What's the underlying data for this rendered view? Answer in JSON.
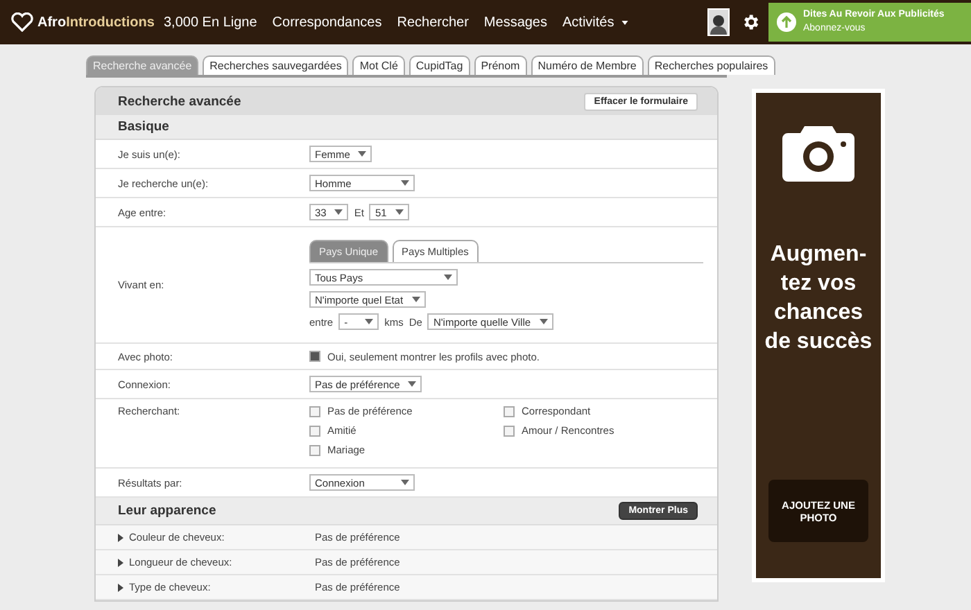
{
  "header": {
    "logo": {
      "part_1": "Afro",
      "part_2": "Introductions"
    },
    "nav": [
      {
        "label": "3,000 En Ligne",
        "dropdown": false
      },
      {
        "label": "Correspondances",
        "dropdown": false
      },
      {
        "label": "Rechercher",
        "dropdown": false
      },
      {
        "label": "Messages",
        "dropdown": false
      },
      {
        "label": "Activités",
        "dropdown": true
      }
    ],
    "promo": {
      "title": "Dites Au Revoir Aux Publicités",
      "subtitle": "Abonnez-vous"
    }
  },
  "tabs": [
    {
      "label": "Recherche avancée",
      "selected": true
    },
    {
      "label": "Recherches sauvegardées",
      "selected": false
    },
    {
      "label": "Mot Clé",
      "selected": false
    },
    {
      "label": "CupidTag",
      "selected": false
    },
    {
      "label": "Prénom",
      "selected": false
    },
    {
      "label": "Numéro de Membre",
      "selected": false
    },
    {
      "label": "Recherches populaires",
      "selected": false
    }
  ],
  "panel": {
    "title": "Recherche avancée",
    "clear_button": "Effacer le formulaire"
  },
  "basic": {
    "title": "Basique",
    "rows": [
      {
        "kind": "dropdown",
        "label": "Je suis un(e):",
        "value": "Femme"
      },
      {
        "kind": "select",
        "label": "Je recherche un(e):",
        "value": "Homme"
      },
      {
        "kind": "range",
        "label": "Age entre:",
        "from": "33",
        "joiner": "Et",
        "to": "51"
      },
      {
        "kind": "location",
        "label": "Vivant en:",
        "tabs": [
          {
            "label": "Pays Unique",
            "selected": true
          },
          {
            "label": "Pays Multiples",
            "selected": false
          }
        ],
        "country": "Tous Pays",
        "state": "N'importe quel Etat",
        "between": "entre",
        "distance": "-",
        "unit": "kms",
        "from": "De",
        "city": "N'importe quelle Ville"
      },
      {
        "kind": "checkbox",
        "label": "Avec photo:",
        "text": "Oui, seulement montrer les profils avec photo.",
        "checked": true
      },
      {
        "kind": "select",
        "label": "Connexion:",
        "value": "Pas de préférence"
      },
      {
        "kind": "checkgrid",
        "label": "Recherchant:",
        "options": [
          {
            "text": "Pas de préférence",
            "checked": false
          },
          {
            "text": "Correspondant",
            "checked": false
          },
          {
            "text": "Amitié",
            "checked": false
          },
          {
            "text": "Amour / Rencontres",
            "checked": false
          },
          {
            "text": "Mariage",
            "checked": false
          }
        ]
      },
      {
        "kind": "select",
        "label": "Résultats par:",
        "value": "Connexion"
      }
    ]
  },
  "appearance": {
    "title": "Leur apparence",
    "more_button": "Montrer Plus",
    "rows": [
      {
        "label": "Couleur de cheveux:",
        "value": "Pas de préférence"
      },
      {
        "label": "Longueur de cheveux:",
        "value": "Pas de préférence"
      },
      {
        "label": "Type de cheveux:",
        "value": "Pas de préférence"
      }
    ]
  },
  "ad": {
    "headline": "Augmen-tez vos chances de succès",
    "button": "AJOUTEZ UNE PHOTO"
  }
}
